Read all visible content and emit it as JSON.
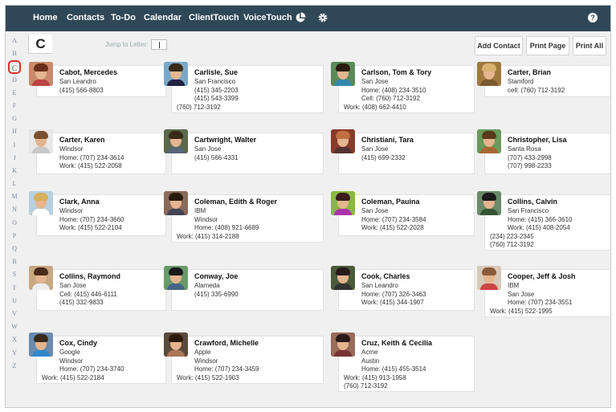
{
  "nav": {
    "home": "Home",
    "contacts": "Contacts",
    "todo": "To-Do",
    "calendar": "Calendar",
    "clienttouch": "ClientTouch",
    "voicetouch": "VoiceTouch",
    "icons": [
      "pie-chart-icon",
      "gear-icon",
      "help-icon"
    ]
  },
  "letters": [
    "A",
    "B",
    "C",
    "D",
    "E",
    "F",
    "G",
    "H",
    "I",
    "J",
    "K",
    "L",
    "M",
    "N",
    "O",
    "P",
    "Q",
    "R",
    "S",
    "T",
    "U",
    "V",
    "W",
    "X",
    "Y",
    "Z"
  ],
  "active_letter": "C",
  "heading_letter": "C",
  "jump_label": "Jump to Letter:",
  "buttons": {
    "add_contact": "Add Contact",
    "print_page": "Print Page",
    "print_all": "Print All"
  },
  "contacts": [
    {
      "name": "Cabot, Mercedes",
      "line1": "San Leandro",
      "line2": "(415) 566-8803",
      "line3": "",
      "line4": "",
      "avatar": {
        "bg": "#c98a6a",
        "hair": "#6a2f1a",
        "shirt": "#b44"
      }
    },
    {
      "name": "Carlisle, Sue",
      "line1": "San Francisco",
      "line2": "(415) 345-2203",
      "line3": "(415) 543-3399",
      "line4": "(760) 712-3192",
      "avatar": {
        "bg": "#7aa8c8",
        "hair": "#3a2a1a",
        "shirt": "#224"
      }
    },
    {
      "name": "Carlson, Tom & Tory",
      "line1": "San Jose",
      "line2": "Home: (408) 234-3510",
      "line3": "Cell: (760) 712-3192",
      "line4": "Work: (408) 662-4410",
      "avatar": {
        "bg": "#5a8a5a",
        "hair": "#2a1a0a",
        "shirt": "#38a"
      }
    },
    {
      "name": "Carter, Brian",
      "line1": "Stamford",
      "line2": "cell: (760) 712-3192",
      "line3": "",
      "line4": "",
      "avatar": {
        "bg": "#a07840",
        "hair": "#d8b070",
        "shirt": "#7a5a30"
      }
    },
    {
      "name": "Carter, Karen",
      "line1": "Windsor",
      "line2": "Home: (707) 234-3614",
      "line3": "Work: (415) 522-2058",
      "line4": "",
      "avatar": {
        "bg": "#e8e8e8",
        "hair": "#7a5030",
        "shirt": "#c8c8c8"
      }
    },
    {
      "name": "Cartwright, Walter",
      "line1": "San Jose",
      "line2": "(415) 566-4331",
      "line3": "",
      "line4": "",
      "avatar": {
        "bg": "#5a6a4a",
        "hair": "#3a2a1a",
        "shirt": "#567"
      }
    },
    {
      "name": "Christiani, Tara",
      "line1": "San Jose",
      "line2": "(415) 699-2332",
      "line3": "",
      "line4": "",
      "avatar": {
        "bg": "#8a3a2a",
        "hair": "#c07040",
        "shirt": "#533"
      }
    },
    {
      "name": "Christopher, Lisa",
      "line1": "Santa Rosa",
      "line2": "(707) 433-2998",
      "line3": "(707) 998-2233",
      "line4": "",
      "avatar": {
        "bg": "#6a9a5a",
        "hair": "#5a3a1a",
        "shirt": "#a63"
      }
    },
    {
      "name": "Clark, Anna",
      "line1": "Windsor",
      "line2": "Home: (707) 234-3660",
      "line3": "Work: (415) 522-2104",
      "line4": "",
      "avatar": {
        "bg": "#b8d0e0",
        "hair": "#d8b060",
        "shirt": "#fff"
      }
    },
    {
      "name": "Coleman, Edith & Roger",
      "line1": "IBM",
      "line2": "Windsor",
      "line3": "Home: (408) 921-6689",
      "line4": "Work: (415) 314-2188",
      "avatar": {
        "bg": "#8a6a5a",
        "hair": "#2a1a0a",
        "shirt": "#445"
      }
    },
    {
      "name": "Coleman, Pauina",
      "line1": "San Jose",
      "line2": "Home: (707) 234-3584",
      "line3": "Work: (415) 522-2028",
      "line4": "",
      "avatar": {
        "bg": "#8ab840",
        "hair": "#3a1a1a",
        "shirt": "#a3a"
      }
    },
    {
      "name": "Collins, Calvin",
      "line1": "San Francisco",
      "line2": "Home: (415) 366-3610",
      "line3": "Work: (415) 408-2054",
      "line4": "(234) 223-2345",
      "line5": "(760) 712-3192",
      "avatar": {
        "bg": "#6a8a6a",
        "hair": "#1a1a1a",
        "shirt": "#353"
      }
    },
    {
      "name": "Collins, Raymond",
      "line1": "San Jose",
      "line2": "Cell: (415) 446-6111",
      "line3": "(415) 332-9833",
      "line4": "",
      "avatar": {
        "bg": "#c8a880",
        "hair": "#4a2a1a",
        "shirt": "#eee"
      }
    },
    {
      "name": "Conway, Joe",
      "line1": "Alameda",
      "line2": "(415) 335-6990",
      "line3": "",
      "line4": "",
      "avatar": {
        "bg": "#6a9a6a",
        "hair": "#1a1a1a",
        "shirt": "#468"
      }
    },
    {
      "name": "Cook, Charles",
      "line1": "San Leandro",
      "line2": "Home: (707) 326-3463",
      "line3": "Work: (415) 344-1907",
      "line4": "",
      "avatar": {
        "bg": "#4a5a3a",
        "hair": "#2a1a1a",
        "shirt": "#333"
      }
    },
    {
      "name": "Cooper, Jeff & Josh",
      "line1": "IBM",
      "line2": "San Jose",
      "line3": "Home: (707) 234-3551",
      "line4": "Work: (415) 522-1995",
      "avatar": {
        "bg": "#d8c8b8",
        "hair": "#8a5a3a",
        "shirt": "#c44"
      }
    },
    {
      "name": "Cox, Cindy",
      "line1": "Google",
      "line2": "Windsor",
      "line3": "Home: (707) 234-3740",
      "line4": "Work: (415) 522-2184",
      "avatar": {
        "bg": "#6a8ab0",
        "hair": "#3a2a1a",
        "shirt": "#38c"
      }
    },
    {
      "name": "Crawford, Michelle",
      "line1": "Apple",
      "line2": "Windsor",
      "line3": "Home: (707) 234-3459",
      "line4": "Work: (415) 522-1903",
      "avatar": {
        "bg": "#5a4a3a",
        "hair": "#2a1a0a",
        "shirt": "#a75"
      }
    },
    {
      "name": "Cruz, Keith & Cecilia",
      "line1": "Acme",
      "line2": "Austin",
      "line3": "Home: (415) 455-3514",
      "line4": "Work: (415) 913-1958",
      "line5": "(760) 712-3192",
      "avatar": {
        "bg": "#9a6a5a",
        "hair": "#2a1a1a",
        "shirt": "#733"
      }
    }
  ],
  "colors": {
    "nav_bg": "#2f4858",
    "active_border": "#e0302f",
    "letter_color": "#7a8aa0"
  }
}
